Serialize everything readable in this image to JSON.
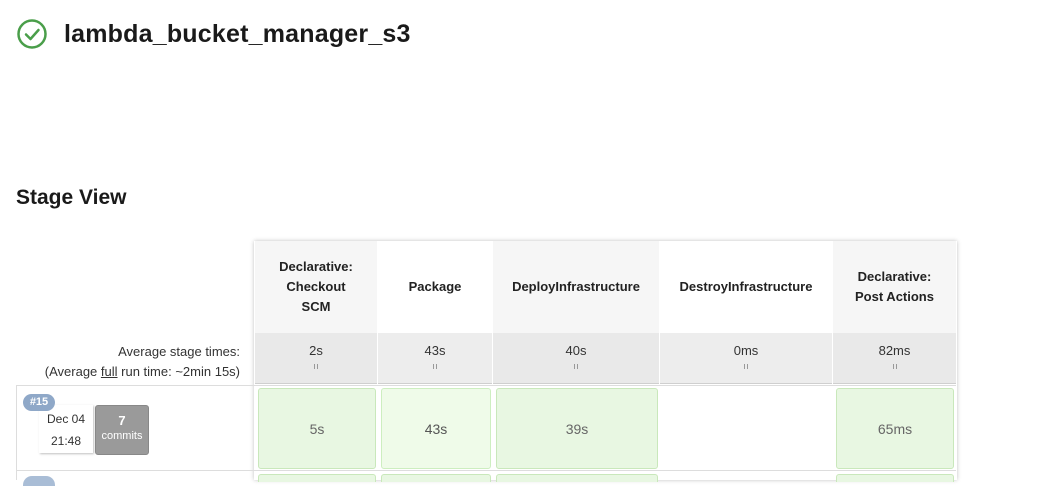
{
  "job": {
    "title": "lambda_bucket_manager_s3",
    "status": "success",
    "status_color": "#4a9e4a"
  },
  "stage_view": {
    "title": "Stage View",
    "avg_label_line1": "Average stage times:",
    "avg_label_prefix": "(Average ",
    "avg_label_link": "full",
    "avg_label_suffix": " run time: ~2min 15s)",
    "stages": [
      {
        "name": "Declarative: Checkout SCM",
        "avg": "2s"
      },
      {
        "name": "Package",
        "avg": "43s"
      },
      {
        "name": "DeployInfrastructure",
        "avg": "40s"
      },
      {
        "name": "DestroyInfrastructure",
        "avg": "0ms"
      },
      {
        "name": "Declarative: Post Actions",
        "avg": "82ms"
      }
    ],
    "builds": [
      {
        "number": "#15",
        "date": "Dec 04",
        "time": "21:48",
        "commits_count": "7",
        "commits_label": "commits",
        "durations": [
          "5s",
          "43s",
          "39s",
          "",
          "65ms"
        ]
      }
    ]
  }
}
